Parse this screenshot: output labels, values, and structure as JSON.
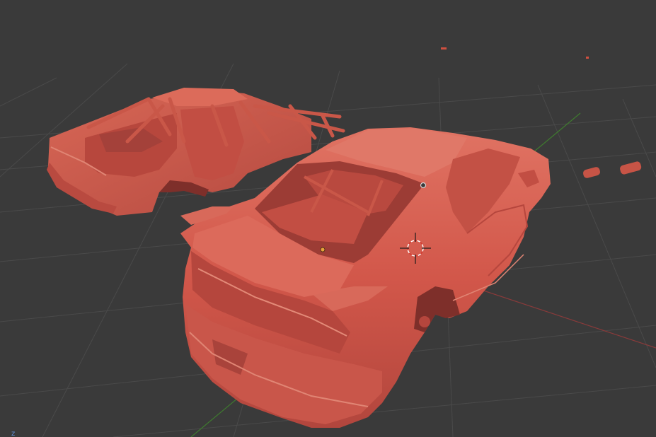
{
  "viewport": {
    "background": "#3a3a3a",
    "grid_color": "#4a4a4a",
    "x_axis_color": "#8a3a3a",
    "y_axis_color": "#3f7a2f",
    "model_color": "#d45a4c",
    "model_shade": "#a8413a",
    "model_highlight": "#e8806f",
    "axis_gizmo_label": "z"
  },
  "scene": {
    "objects": [
      "stripped-body-shell-with-roll-cage",
      "complete-car-body",
      "small-part-a",
      "small-part-b",
      "light-helper",
      "empty-helper"
    ],
    "cursor_icon": "3d-cursor-icon",
    "light_icon": "light-icon",
    "origin_icon": "object-origin-icon"
  }
}
